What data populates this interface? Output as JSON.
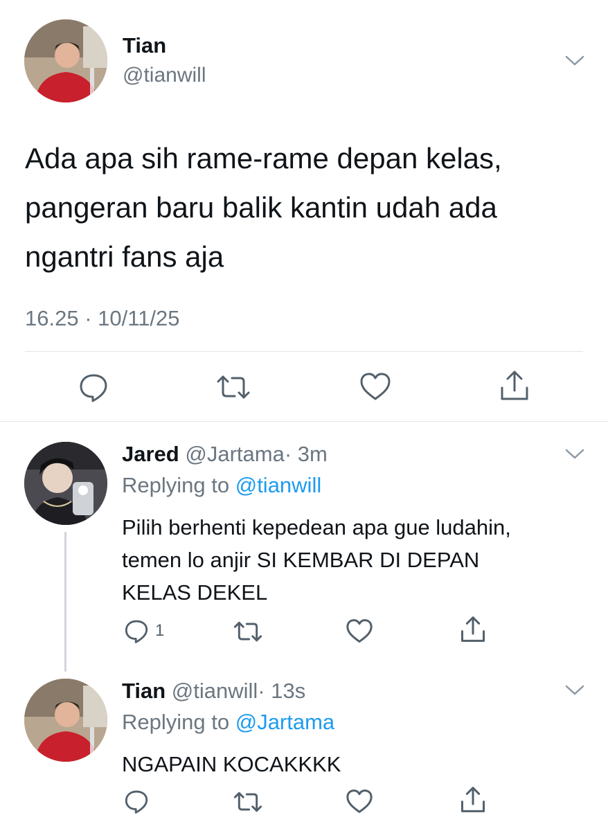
{
  "main_tweet": {
    "author_name": "Tian",
    "author_handle": "@tianwill",
    "text_lines": [
      "Ada apa sih rame-rame depan kelas,",
      "pangeran baru balik kantin udah ada",
      "ngantri fans aja"
    ],
    "timestamp": "16.25 · 10/11/25"
  },
  "replies": [
    {
      "author_name": "Jared",
      "author_handle": "@Jartama",
      "time": "· 3m",
      "replying_prefix": "Replying to",
      "replying_to": "@tianwill",
      "text_lines": [
        "Pilih berhenti kepedean apa gue ludahin,",
        "temen lo anjir SI KEMBAR DI DEPAN",
        "KELAS DEKEL"
      ],
      "reply_count": "1"
    },
    {
      "author_name": "Tian",
      "author_handle": "@tianwill",
      "time": "· 13s",
      "replying_prefix": "Replying to",
      "replying_to": "@Jartama",
      "text_lines": [
        "NGAPAIN KOCAKKKK"
      ],
      "reply_count": ""
    }
  ],
  "icons": {
    "menu": "chevron-down-icon",
    "reply": "reply-icon",
    "retweet": "retweet-icon",
    "like": "heart-icon",
    "share": "share-icon"
  },
  "colors": {
    "link": "#1d9bf0",
    "secondary": "#6b7680",
    "text": "#0f1419"
  }
}
